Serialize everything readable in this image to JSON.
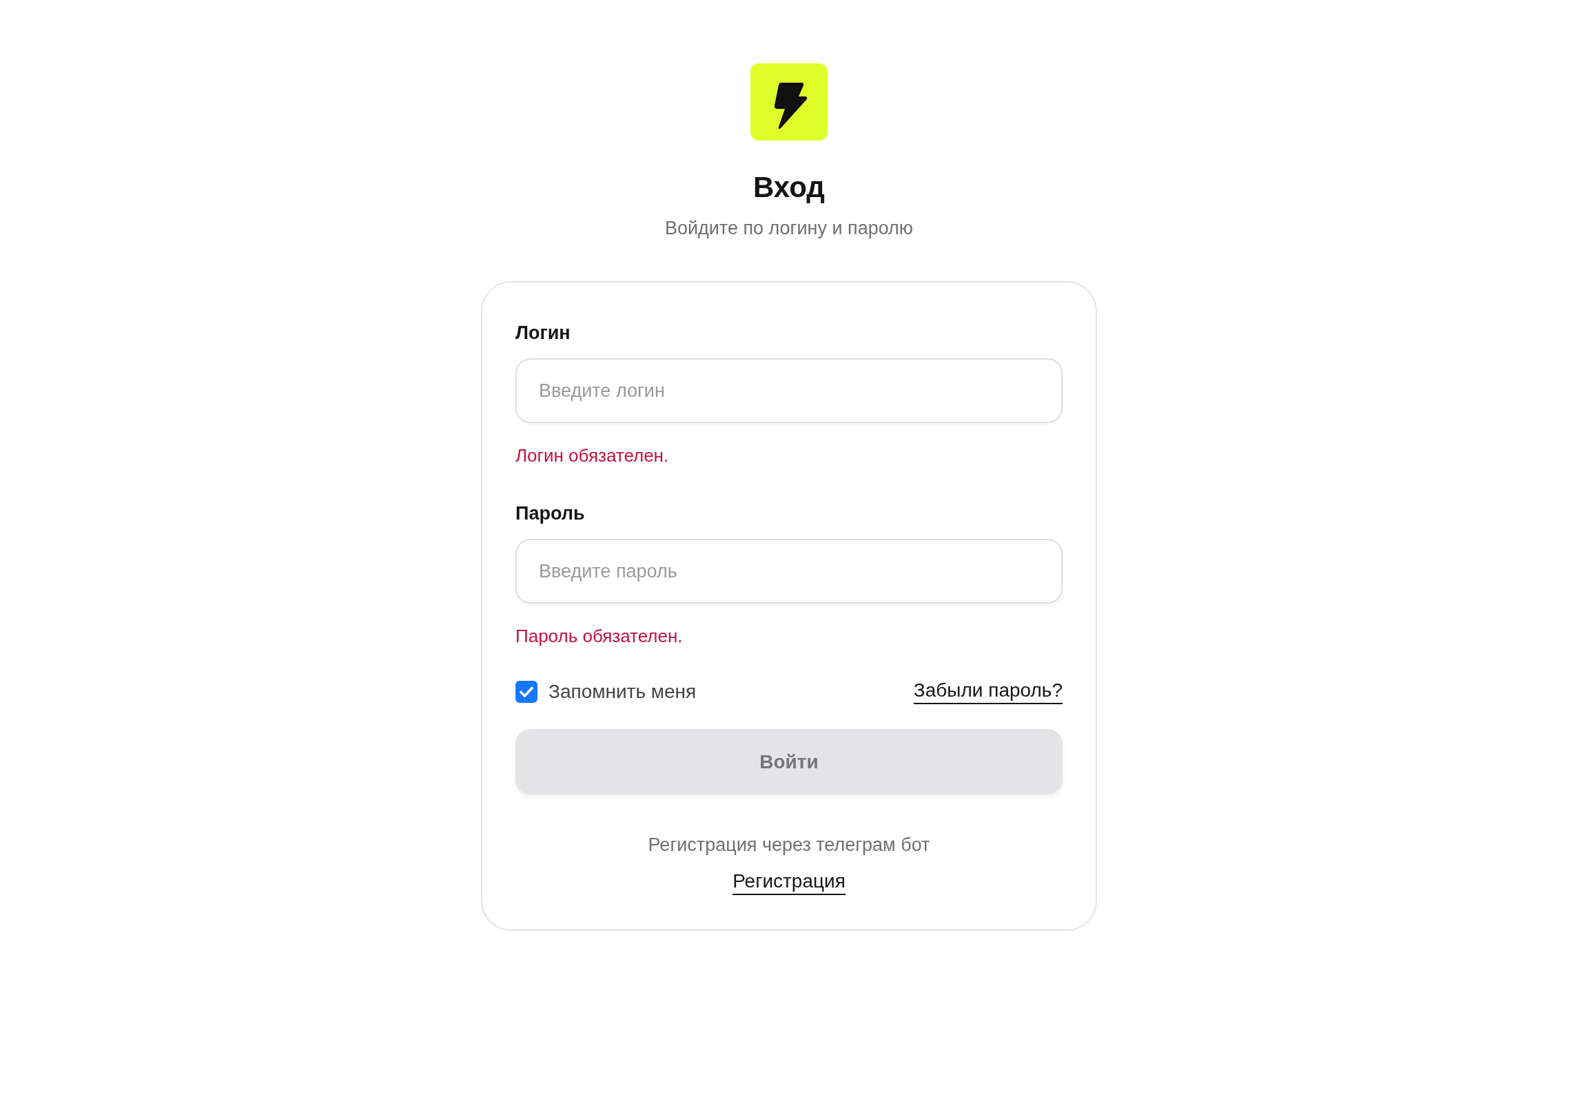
{
  "header": {
    "title": "Вход",
    "subtitle": "Войдите по логину и паролю"
  },
  "fields": [
    {
      "label": "Логин",
      "placeholder": "Введите логин",
      "error": "Логин обязателен."
    },
    {
      "label": "Пароль",
      "placeholder": "Введите пароль",
      "error": "Пароль обязателен."
    }
  ],
  "remember": {
    "label": "Запомнить меня",
    "checked": true
  },
  "forgot_link": "Забыли пароль?",
  "submit": {
    "label": "Войти",
    "disabled": true
  },
  "register": {
    "text": "Регистрация через телеграм бот",
    "link": "Регистрация"
  }
}
